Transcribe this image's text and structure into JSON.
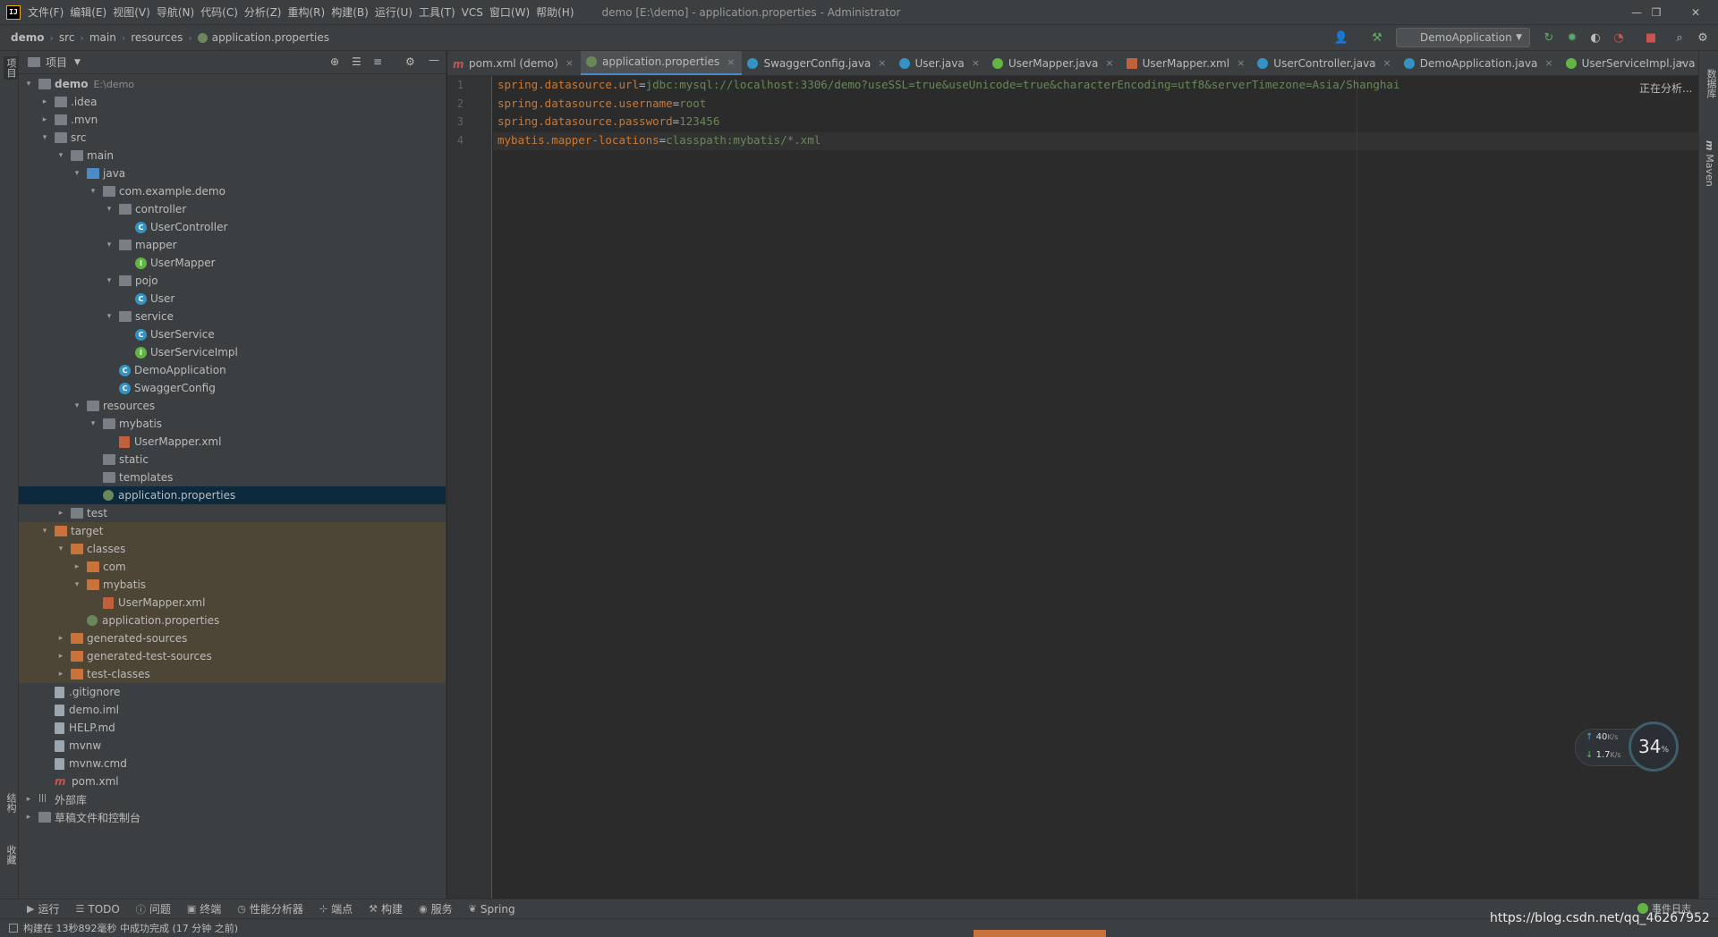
{
  "app": {
    "window_title": "demo [E:\\demo] - application.properties - Administrator",
    "logo_text": "IJ",
    "menu": [
      "文件(F)",
      "编辑(E)",
      "视图(V)",
      "导航(N)",
      "代码(C)",
      "分析(Z)",
      "重构(R)",
      "构建(B)",
      "运行(U)",
      "工具(T)",
      "VCS",
      "窗口(W)",
      "帮助(H)"
    ]
  },
  "breadcrumb": [
    "demo",
    "src",
    "main",
    "resources",
    "application.properties"
  ],
  "run_config": "DemoApplication",
  "left_stripe": {
    "project": "项目",
    "structure": "结构",
    "favorites": "收藏"
  },
  "right_stripe": {
    "database": "数据库",
    "maven": "Maven"
  },
  "project_panel": {
    "title": "项目",
    "tree": [
      {
        "label": "demo",
        "extra": "E:\\demo",
        "depth": 0,
        "arrow": "open",
        "icon": "folder-gray",
        "bold": true
      },
      {
        "label": ".idea",
        "depth": 1,
        "arrow": "closed",
        "icon": "folder-gray"
      },
      {
        "label": ".mvn",
        "depth": 1,
        "arrow": "closed",
        "icon": "folder-gray"
      },
      {
        "label": "src",
        "depth": 1,
        "arrow": "open",
        "icon": "folder-gray"
      },
      {
        "label": "main",
        "depth": 2,
        "arrow": "open",
        "icon": "folder-gray"
      },
      {
        "label": "java",
        "depth": 3,
        "arrow": "open",
        "icon": "folder-blue"
      },
      {
        "label": "com.example.demo",
        "depth": 4,
        "arrow": "open",
        "icon": "folder-gray"
      },
      {
        "label": "controller",
        "depth": 5,
        "arrow": "open",
        "icon": "folder-gray"
      },
      {
        "label": "UserController",
        "depth": 6,
        "arrow": "none",
        "icon": "class"
      },
      {
        "label": "mapper",
        "depth": 5,
        "arrow": "open",
        "icon": "folder-gray"
      },
      {
        "label": "UserMapper",
        "depth": 6,
        "arrow": "none",
        "icon": "interface"
      },
      {
        "label": "pojo",
        "depth": 5,
        "arrow": "open",
        "icon": "folder-gray"
      },
      {
        "label": "User",
        "depth": 6,
        "arrow": "none",
        "icon": "class"
      },
      {
        "label": "service",
        "depth": 5,
        "arrow": "open",
        "icon": "folder-gray"
      },
      {
        "label": "UserService",
        "depth": 6,
        "arrow": "none",
        "icon": "class"
      },
      {
        "label": "UserServiceImpl",
        "depth": 6,
        "arrow": "none",
        "icon": "interface"
      },
      {
        "label": "DemoApplication",
        "depth": 5,
        "arrow": "none",
        "icon": "class"
      },
      {
        "label": "SwaggerConfig",
        "depth": 5,
        "arrow": "none",
        "icon": "class"
      },
      {
        "label": "resources",
        "depth": 3,
        "arrow": "open",
        "icon": "folder-gray"
      },
      {
        "label": "mybatis",
        "depth": 4,
        "arrow": "open",
        "icon": "folder-gray"
      },
      {
        "label": "UserMapper.xml",
        "depth": 5,
        "arrow": "none",
        "icon": "xml"
      },
      {
        "label": "static",
        "depth": 4,
        "arrow": "none",
        "icon": "folder-gray"
      },
      {
        "label": "templates",
        "depth": 4,
        "arrow": "none",
        "icon": "folder-gray"
      },
      {
        "label": "application.properties",
        "depth": 4,
        "arrow": "none",
        "icon": "properties",
        "selected": true
      },
      {
        "label": "test",
        "depth": 2,
        "arrow": "closed",
        "icon": "folder-gray"
      },
      {
        "label": "target",
        "depth": 1,
        "arrow": "open",
        "icon": "folder-orange",
        "excluded": true
      },
      {
        "label": "classes",
        "depth": 2,
        "arrow": "open",
        "icon": "folder-orange",
        "excluded": true
      },
      {
        "label": "com",
        "depth": 3,
        "arrow": "closed",
        "icon": "folder-orange",
        "excluded": true
      },
      {
        "label": "mybatis",
        "depth": 3,
        "arrow": "open",
        "icon": "folder-orange",
        "excluded": true
      },
      {
        "label": "UserMapper.xml",
        "depth": 4,
        "arrow": "none",
        "icon": "xml",
        "excluded": true
      },
      {
        "label": "application.properties",
        "depth": 3,
        "arrow": "none",
        "icon": "properties",
        "excluded": true
      },
      {
        "label": "generated-sources",
        "depth": 2,
        "arrow": "closed",
        "icon": "folder-orange",
        "excluded": true
      },
      {
        "label": "generated-test-sources",
        "depth": 2,
        "arrow": "closed",
        "icon": "folder-orange",
        "excluded": true
      },
      {
        "label": "test-classes",
        "depth": 2,
        "arrow": "closed",
        "icon": "folder-orange",
        "excluded": true
      },
      {
        "label": ".gitignore",
        "depth": 1,
        "arrow": "none",
        "icon": "file"
      },
      {
        "label": "demo.iml",
        "depth": 1,
        "arrow": "none",
        "icon": "file"
      },
      {
        "label": "HELP.md",
        "depth": 1,
        "arrow": "none",
        "icon": "file"
      },
      {
        "label": "mvnw",
        "depth": 1,
        "arrow": "none",
        "icon": "file"
      },
      {
        "label": "mvnw.cmd",
        "depth": 1,
        "arrow": "none",
        "icon": "file"
      },
      {
        "label": "pom.xml",
        "depth": 1,
        "arrow": "none",
        "icon": "maven"
      },
      {
        "label": "外部库",
        "depth": 0,
        "arrow": "closed",
        "icon": "library"
      },
      {
        "label": "草稿文件和控制台",
        "depth": 0,
        "arrow": "closed",
        "icon": "scratch"
      }
    ]
  },
  "tabs": [
    {
      "label": "pom.xml (demo)",
      "icon": "maven",
      "close": "×"
    },
    {
      "label": "application.properties",
      "icon": "properties",
      "active": true,
      "close": "×"
    },
    {
      "label": "SwaggerConfig.java",
      "icon": "class",
      "close": "×"
    },
    {
      "label": "User.java",
      "icon": "class",
      "close": "×"
    },
    {
      "label": "UserMapper.java",
      "icon": "interface",
      "close": "×"
    },
    {
      "label": "UserMapper.xml",
      "icon": "xml",
      "close": "×"
    },
    {
      "label": "UserController.java",
      "icon": "class",
      "close": "×"
    },
    {
      "label": "DemoApplication.java",
      "icon": "class",
      "close": "×"
    },
    {
      "label": "UserServiceImpl.java",
      "icon": "interface",
      "close": ""
    }
  ],
  "editor": {
    "lines": [
      {
        "num": "1",
        "key": "spring.datasource.url",
        "eq": "=",
        "value": "jdbc:mysql://localhost:3306/demo?useSSL=true&useUnicode=true&characterEncoding=utf8&serverTimezone=Asia/Shanghai"
      },
      {
        "num": "2",
        "key": "spring.datasource.username",
        "eq": "=",
        "value": "root"
      },
      {
        "num": "3",
        "key": "spring.datasource.password",
        "eq": "=",
        "value": "123456"
      },
      {
        "num": "4",
        "key": "mybatis.mapper-locations",
        "eq": "=",
        "value": "classpath:mybatis/*.xml"
      }
    ],
    "analyzing": "正在分析..."
  },
  "net_widget": {
    "upload": "40",
    "upload_unit": "K/s",
    "download": "1.7",
    "download_unit": "K/s",
    "percent": "34",
    "percent_unit": "%"
  },
  "bottom_tools": [
    "运行",
    "TODO",
    "问题",
    "终端",
    "性能分析器",
    "端点",
    "构建",
    "服务",
    "Spring"
  ],
  "event_log": "事件日志",
  "status": "构建在 13秒892毫秒 中成功完成 (17 分钟 之前)",
  "watermark": "https://blog.csdn.net/qq_46267952",
  "colors": {
    "key": "#cc7832",
    "value": "#6a8759",
    "bg": "#2b2b2b",
    "panel": "#3c3f41",
    "selection": "#0d293e",
    "excluded": "#4d4637"
  }
}
